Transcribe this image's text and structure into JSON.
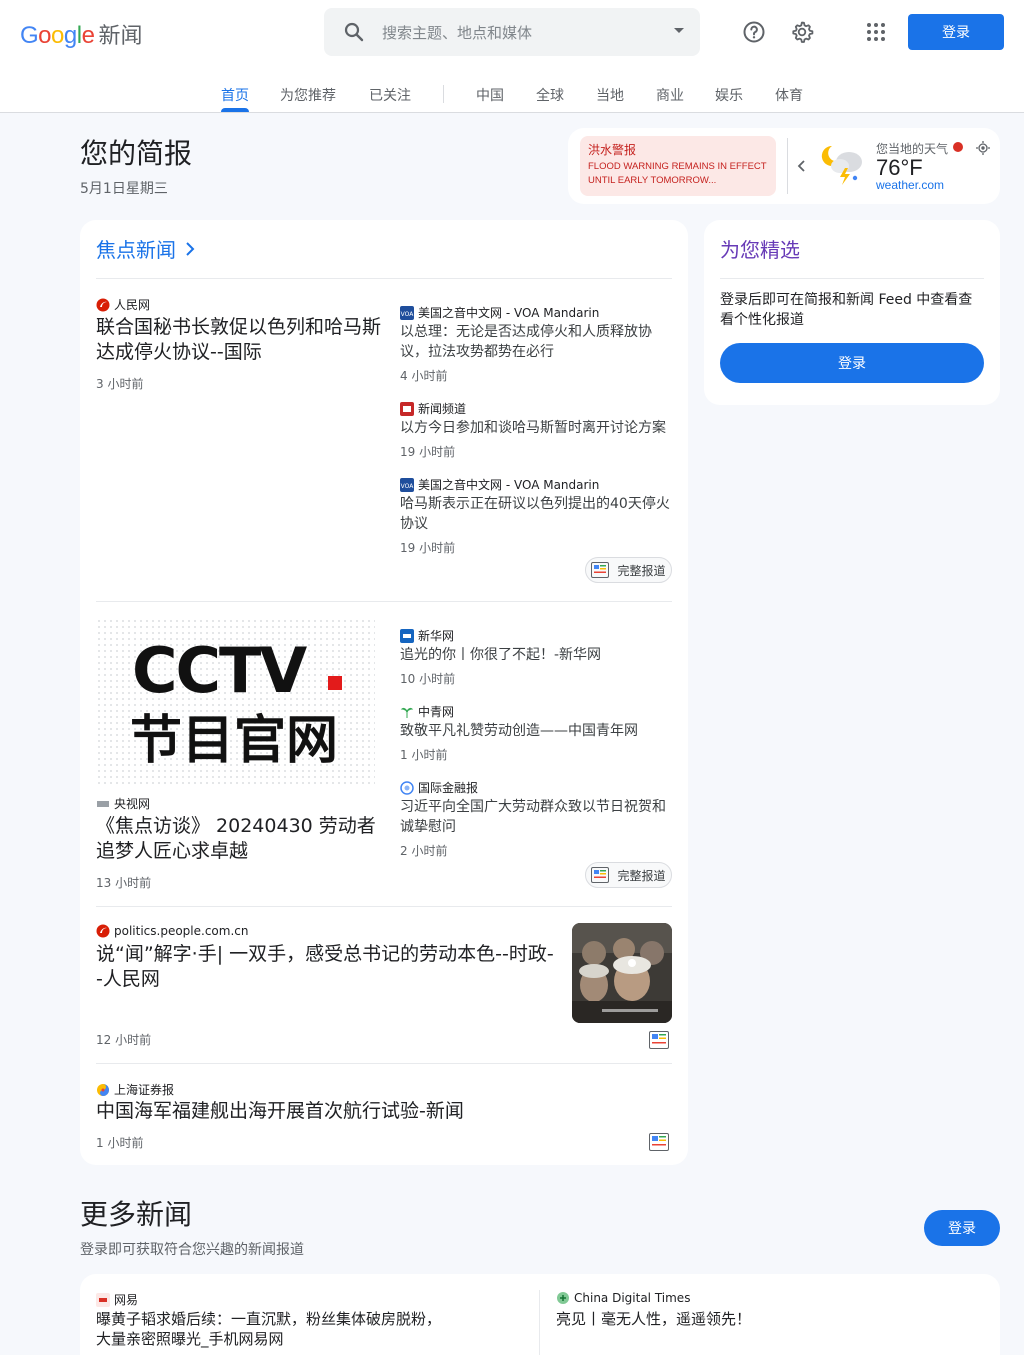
{
  "header": {
    "logo_google": "Google",
    "logo_news": "新闻",
    "search_placeholder": "搜索主题、地点和媒体",
    "signin": "登录",
    "colors": {
      "blue": "#4285f4",
      "red": "#ea4335",
      "yellow": "#fbbc05",
      "green": "#34a853",
      "accent": "#1a73e8"
    }
  },
  "nav": {
    "tabs": [
      "首页",
      "为您推荐",
      "已关注",
      "中国",
      "全球",
      "当地",
      "商业",
      "娱乐",
      "体育"
    ]
  },
  "briefing": {
    "title": "您的简报",
    "date": "5月1日星期三"
  },
  "alert": {
    "title": "洪水警报",
    "text": "FLOOD WARNING REMAINS IN EFFECT UNTIL EARLY TOMORROW..."
  },
  "weather": {
    "label": "您当地的天气",
    "temp": "76°F",
    "source": "weather.com"
  },
  "top_stories": {
    "heading": "焦点新闻",
    "full_coverage": "完整报道",
    "clusters": [
      {
        "main": {
          "source": "人民网",
          "title": "联合国秘书长敦促以色列和哈马斯达成停火协议--国际",
          "time": "3 小时前"
        },
        "related": [
          {
            "source": "美国之音中文网 - VOA Mandarin",
            "title": "以总理：无论是否达成停火和人质释放协议，拉法攻势都势在必行",
            "time": "4 小时前"
          },
          {
            "source": "新闻频道",
            "title": "以方今日参加和谈哈马斯暂时离开讨论方案",
            "time": "19 小时前"
          },
          {
            "source": "美国之音中文网 - VOA Mandarin",
            "title": "哈马斯表示正在研议以色列提出的40天停火协议",
            "time": "19 小时前"
          }
        ]
      },
      {
        "main": {
          "source": "央视网",
          "title": "《焦点访谈》 20240430 劳动者追梦人匠心求卓越",
          "time": "13 小时前",
          "image_text_top": "CCTV",
          "image_text_bottom": "节目官网"
        },
        "related": [
          {
            "source": "新华网",
            "title": "追光的你丨你很了不起！-新华网",
            "time": "10 小时前"
          },
          {
            "source": "中青网",
            "title": "致敬平凡礼赞劳动创造——中国青年网",
            "time": "1 小时前"
          },
          {
            "source": "国际金融报",
            "title": "习近平向全国广大劳动群众致以节日祝贺和诚挚慰问",
            "time": "2 小时前"
          }
        ]
      }
    ],
    "singles": [
      {
        "source": "politics.people.com.cn",
        "title": "说“闻”解字·手| 一双手，感受总书记的劳动本色--时政--人民网",
        "time": "12 小时前"
      },
      {
        "source": "上海证券报",
        "title": "中国海军福建舰出海开展首次航行试验-新闻",
        "time": "1 小时前"
      }
    ]
  },
  "picks": {
    "title": "为您精选",
    "text": "登录后即可在简报和新闻 Feed 中查看查看个性化报道",
    "button": "登录"
  },
  "more_news": {
    "title": "更多新闻",
    "subtitle": "登录即可获取符合您兴趣的新闻报道",
    "button": "登录",
    "items": [
      {
        "source": "网易",
        "title": "曝黄子韬求婚后续：一直沉默，粉丝集体破房脱粉，大量亲密照曝光_手机网易网"
      },
      {
        "source": "China Digital Times",
        "title": "亮见丨毫无人性，遥遥领先！"
      }
    ]
  }
}
